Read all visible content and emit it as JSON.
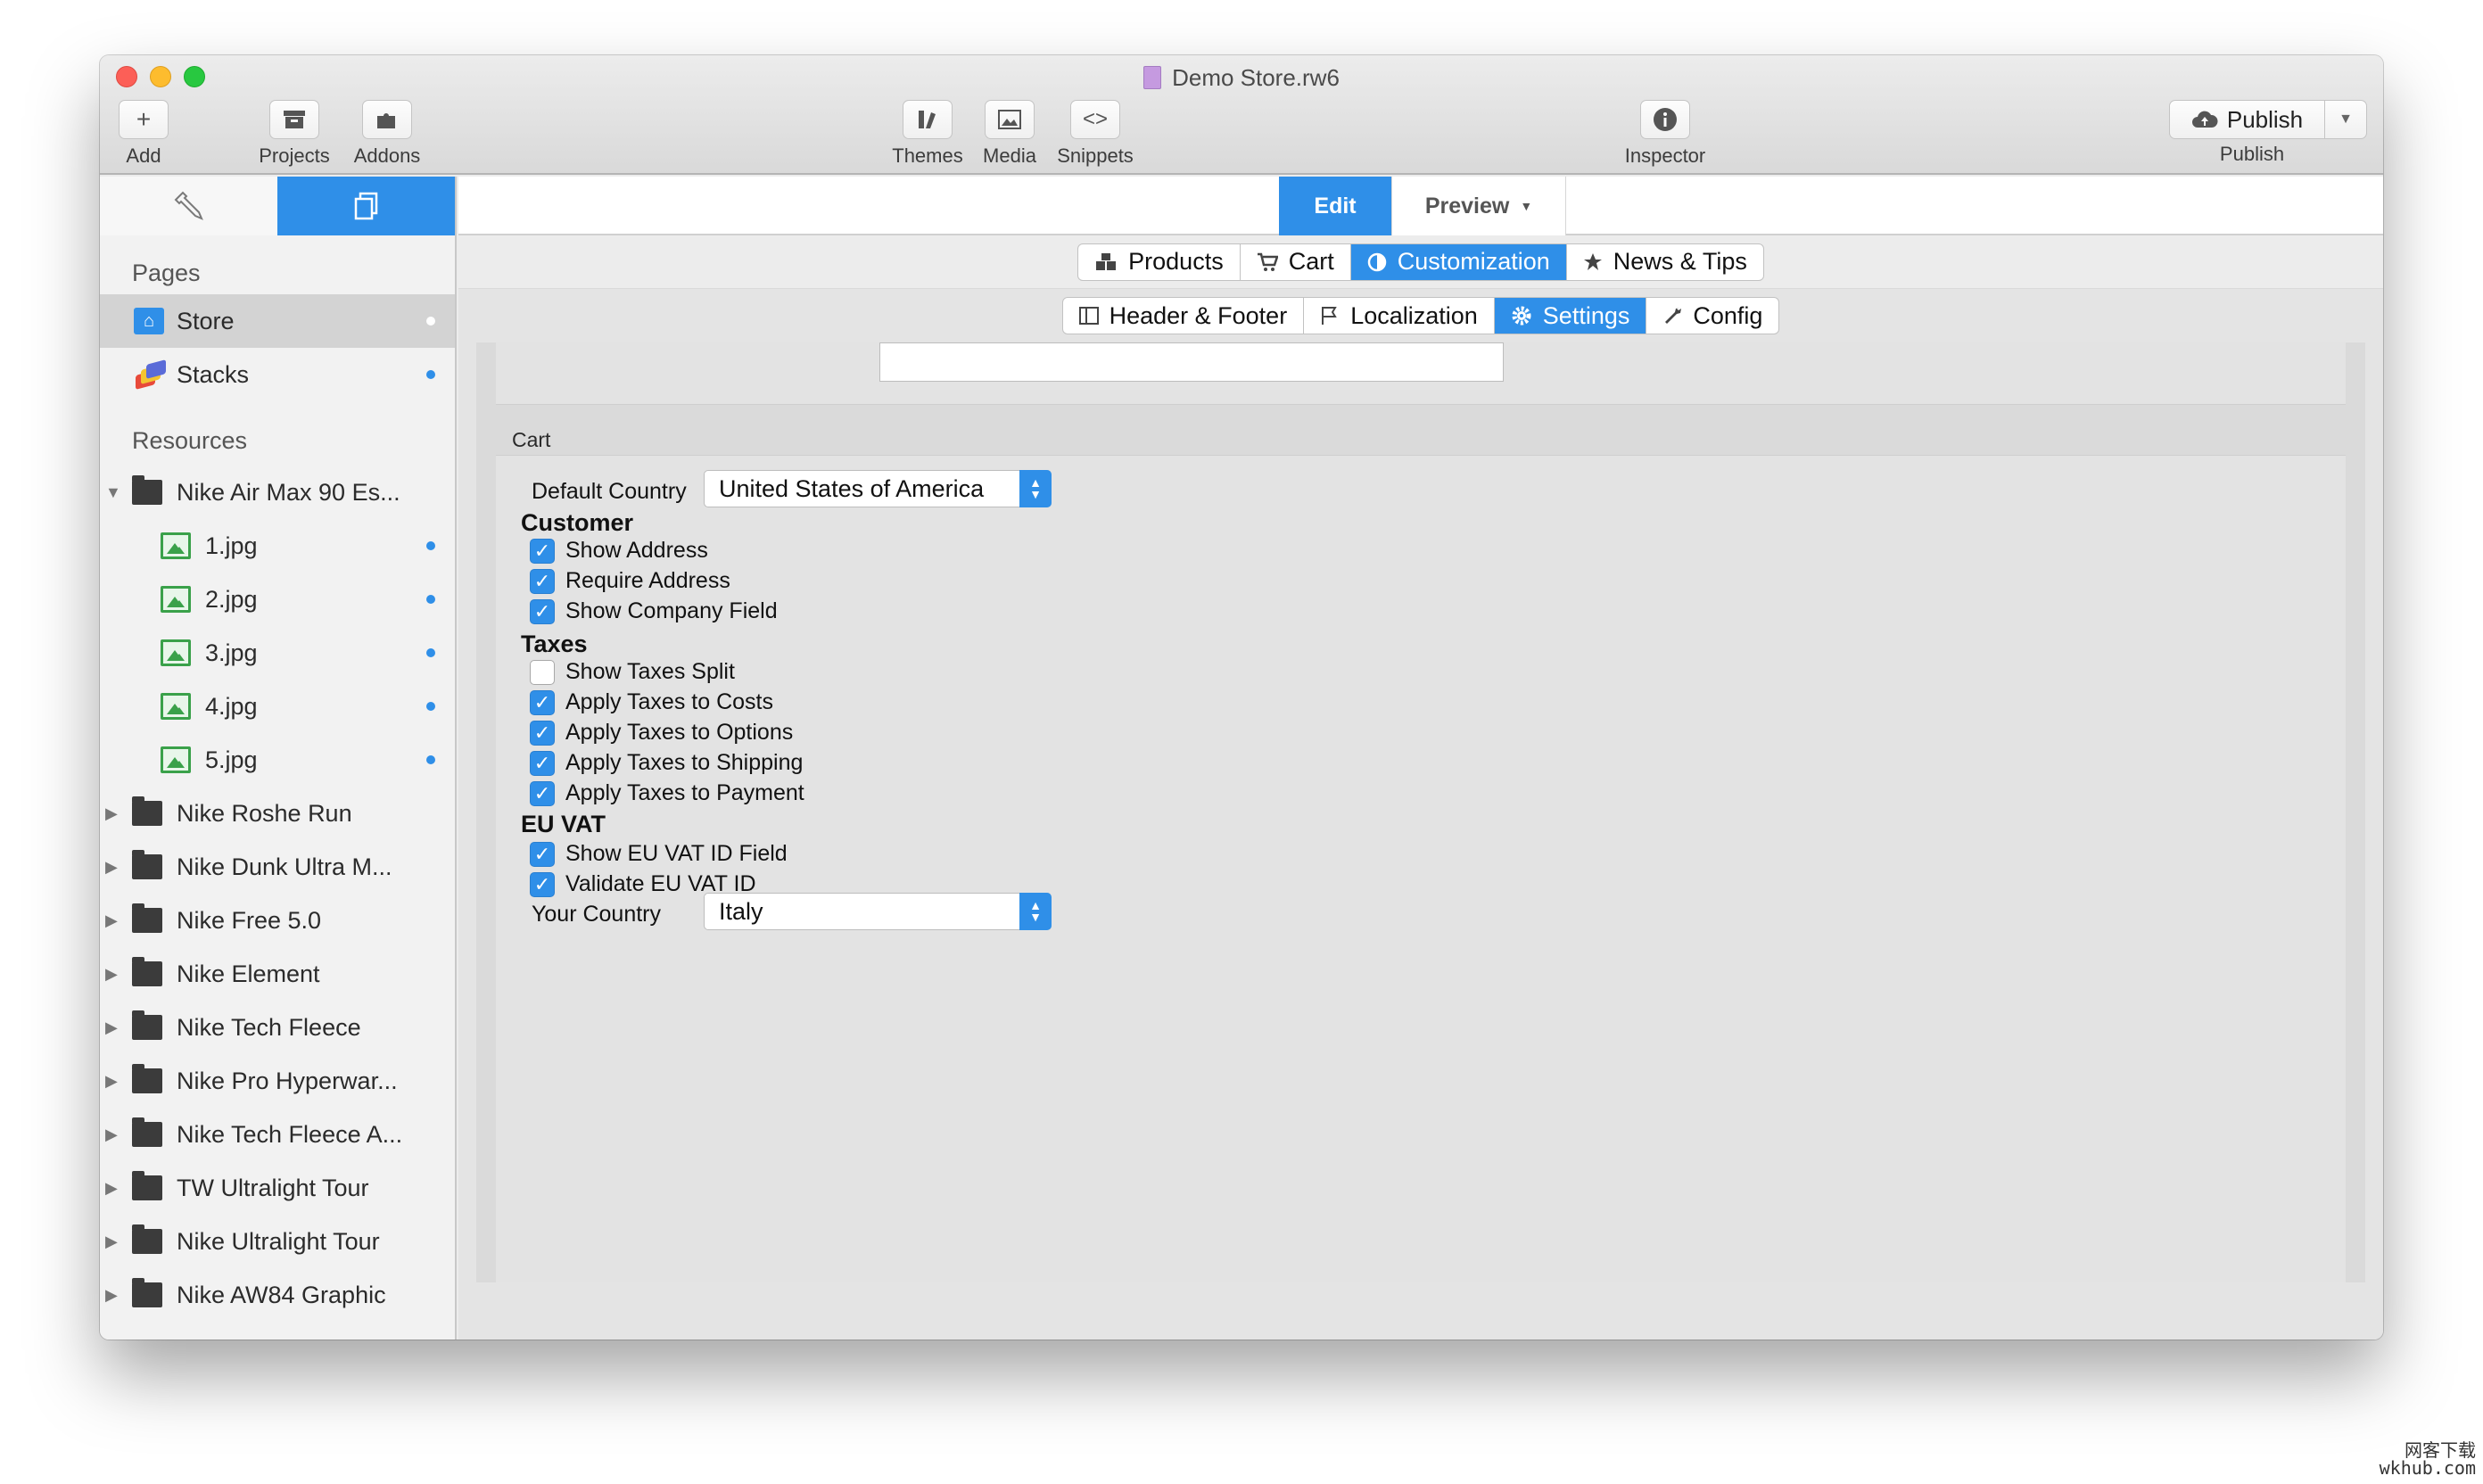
{
  "window": {
    "title": "Demo Store.rw6"
  },
  "toolbar": {
    "add": "Add",
    "projects": "Projects",
    "addons": "Addons",
    "themes": "Themes",
    "media": "Media",
    "snippets": "Snippets",
    "inspector": "Inspector",
    "publish_button": "Publish",
    "publish_label": "Publish"
  },
  "sidebar": {
    "pages_heading": "Pages",
    "pages": [
      {
        "label": "Store",
        "selected": true
      },
      {
        "label": "Stacks",
        "selected": false
      }
    ],
    "resources_heading": "Resources",
    "resources": [
      {
        "label": "Nike Air Max 90 Es...",
        "type": "folder",
        "expanded": true
      },
      {
        "label": "1.jpg",
        "type": "image"
      },
      {
        "label": "2.jpg",
        "type": "image"
      },
      {
        "label": "3.jpg",
        "type": "image"
      },
      {
        "label": "4.jpg",
        "type": "image"
      },
      {
        "label": "5.jpg",
        "type": "image"
      },
      {
        "label": "Nike Roshe Run",
        "type": "folder"
      },
      {
        "label": "Nike Dunk Ultra M...",
        "type": "folder"
      },
      {
        "label": "Nike Free 5.0",
        "type": "folder"
      },
      {
        "label": "Nike Element",
        "type": "folder"
      },
      {
        "label": "Nike Tech Fleece",
        "type": "folder"
      },
      {
        "label": "Nike Pro Hyperwar...",
        "type": "folder"
      },
      {
        "label": "Nike Tech Fleece A...",
        "type": "folder"
      },
      {
        "label": "TW Ultralight Tour",
        "type": "folder"
      },
      {
        "label": "Nike Ultralight Tour",
        "type": "folder"
      },
      {
        "label": "Nike AW84 Graphic",
        "type": "folder"
      }
    ]
  },
  "mode": {
    "edit": "Edit",
    "preview": "Preview"
  },
  "tabs_primary": [
    {
      "label": "Products",
      "active": false,
      "icon": "cubes-icon"
    },
    {
      "label": "Cart",
      "active": false,
      "icon": "cart-icon"
    },
    {
      "label": "Customization",
      "active": true,
      "icon": "contrast-icon"
    },
    {
      "label": "News & Tips",
      "active": false,
      "icon": "star-icon"
    }
  ],
  "tabs_secondary": [
    {
      "label": "Header & Footer",
      "active": false,
      "icon": "layout-icon"
    },
    {
      "label": "Localization",
      "active": false,
      "icon": "flag-icon"
    },
    {
      "label": "Settings",
      "active": true,
      "icon": "gear-icon"
    },
    {
      "label": "Config",
      "active": false,
      "icon": "wrench-icon"
    }
  ],
  "cart": {
    "section_label": "Cart",
    "default_country_label": "Default Country",
    "default_country_value": "United States of America",
    "customer_heading": "Customer",
    "show_address": "Show Address",
    "require_address": "Require Address",
    "show_company_field": "Show Company Field",
    "taxes_heading": "Taxes",
    "show_taxes_split": "Show Taxes Split",
    "apply_taxes_costs": "Apply Taxes to Costs",
    "apply_taxes_options": "Apply Taxes to Options",
    "apply_taxes_shipping": "Apply Taxes to Shipping",
    "apply_taxes_payment": "Apply Taxes to Payment",
    "euvat_heading": "EU VAT",
    "show_euvat_field": "Show EU VAT ID Field",
    "validate_euvat": "Validate EU VAT ID",
    "your_country_label": "Your Country",
    "your_country_value": "Italy"
  },
  "colors": {
    "accent": "#2f8fe8"
  },
  "watermark": {
    "line1": "网客下载",
    "line2": "wkhub.com"
  }
}
